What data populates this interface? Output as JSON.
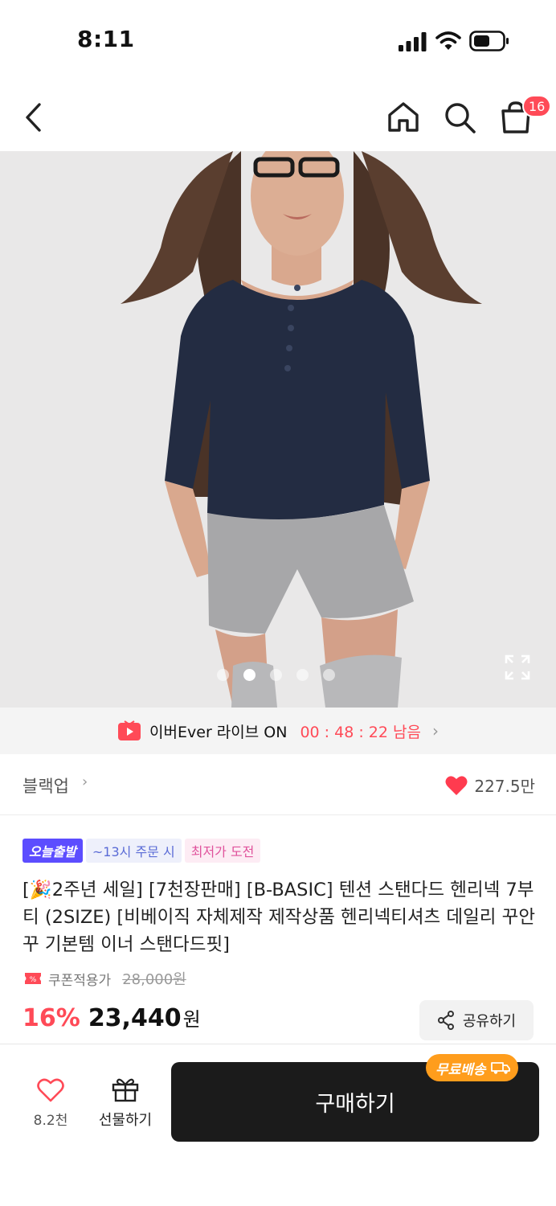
{
  "status_bar": {
    "time": "8:11"
  },
  "nav": {
    "cart_count": "16"
  },
  "image": {
    "page_indicator": {
      "count": 5,
      "active_index": 1
    }
  },
  "live_banner": {
    "text": "이버Ever 라이브 ON",
    "timer": "00 : 48 : 22 남음"
  },
  "brand": {
    "name": "블랙업",
    "like_count": "227.5만"
  },
  "tags": {
    "today_ship": "오늘출발",
    "order_by": "~13시 주문 시",
    "lowest_price": "최저가 도전"
  },
  "product": {
    "title": "[🎉2주년 세일] [7천장판매] [B-BASIC] 텐션 스탠다드 헨리넥 7부티 (2SIZE) [비베이직 자체제작 제작상품 헨리넥티셔츠 데일리 꾸안꾸 기본템 이너 스탠다드핏]",
    "coupon_label": "쿠폰적용가",
    "original_price": "28,000원",
    "discount": "16%",
    "price": "23,440",
    "price_unit": "원"
  },
  "share": {
    "label": "공유하기"
  },
  "bottom_bar": {
    "like_count": "8.2천",
    "gift_label": "선물하기",
    "buy_label": "구매하기",
    "free_shipping": "무료배송"
  },
  "colors": {
    "accent_red": "#ff4a57",
    "today_tag": "#5c4dff",
    "free_ship": "#ff9d1c",
    "buy_button": "#1b1b1b"
  }
}
